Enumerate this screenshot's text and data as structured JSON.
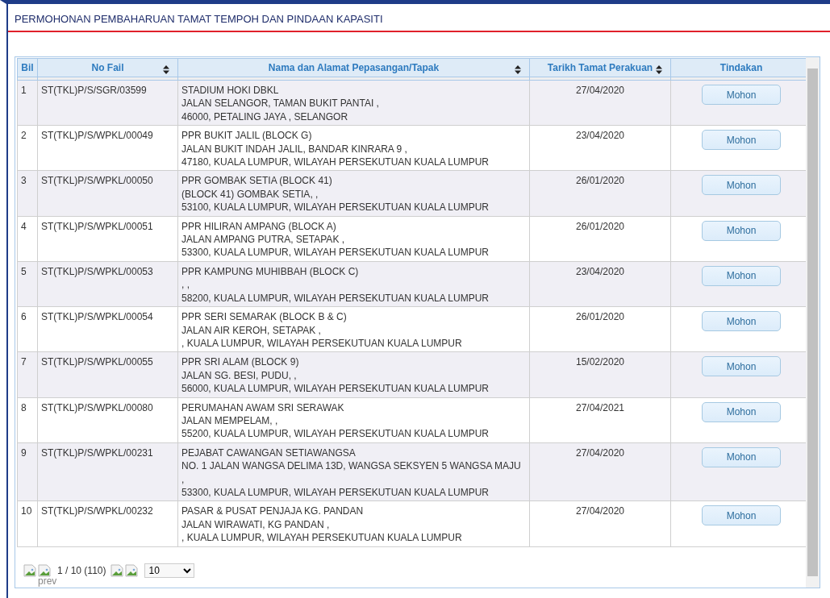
{
  "page_title": "PERMOHONAN PEMBAHARUAN TAMAT TEMPOH DAN PINDAAN KAPASITI",
  "table": {
    "columns": [
      {
        "label": "Bil",
        "sortable": false
      },
      {
        "label": "No Fail",
        "sortable": true
      },
      {
        "label": "Nama dan Alamat Pepasangan/Tapak",
        "sortable": true
      },
      {
        "label": "Tarikh Tamat Perakuan",
        "sortable": true
      },
      {
        "label": "Tindakan",
        "sortable": false
      }
    ],
    "rows": [
      {
        "bil": "1",
        "no_fail": "ST(TKL)P/S/SGR/03599",
        "address": [
          "STADIUM HOKI DBKL",
          "JALAN SELANGOR, TAMAN BUKIT PANTAI ,",
          "46000, PETALING JAYA , SELANGOR"
        ],
        "date": "27/04/2020",
        "action": "Mohon"
      },
      {
        "bil": "2",
        "no_fail": "ST(TKL)P/S/WPKL/00049",
        "address": [
          "PPR BUKIT JALIL (BLOCK G)",
          "JALAN BUKIT INDAH JALIL, BANDAR KINRARA 9 ,",
          "47180, KUALA LUMPUR, WILAYAH PERSEKUTUAN KUALA LUMPUR"
        ],
        "date": "23/04/2020",
        "action": "Mohon"
      },
      {
        "bil": "3",
        "no_fail": "ST(TKL)P/S/WPKL/00050",
        "address": [
          "PPR GOMBAK SETIA (BLOCK 41)",
          "(BLOCK 41) GOMBAK SETIA, ,",
          "53100, KUALA LUMPUR, WILAYAH PERSEKUTUAN KUALA LUMPUR"
        ],
        "date": "26/01/2020",
        "action": "Mohon"
      },
      {
        "bil": "4",
        "no_fail": "ST(TKL)P/S/WPKL/00051",
        "address": [
          "PPR HILIRAN AMPANG (BLOCK A)",
          "JALAN AMPANG PUTRA, SETAPAK ,",
          "53300, KUALA LUMPUR, WILAYAH PERSEKUTUAN KUALA LUMPUR"
        ],
        "date": "26/01/2020",
        "action": "Mohon"
      },
      {
        "bil": "5",
        "no_fail": "ST(TKL)P/S/WPKL/00053",
        "address": [
          "PPR KAMPUNG MUHIBBAH (BLOCK C)",
          ", ,",
          "58200, KUALA LUMPUR, WILAYAH PERSEKUTUAN KUALA LUMPUR"
        ],
        "date": "23/04/2020",
        "action": "Mohon"
      },
      {
        "bil": "6",
        "no_fail": "ST(TKL)P/S/WPKL/00054",
        "address": [
          "PPR SERI SEMARAK (BLOCK B & C)",
          "JALAN AIR KEROH, SETAPAK ,",
          ", KUALA LUMPUR, WILAYAH PERSEKUTUAN KUALA LUMPUR"
        ],
        "date": "26/01/2020",
        "action": "Mohon"
      },
      {
        "bil": "7",
        "no_fail": "ST(TKL)P/S/WPKL/00055",
        "address": [
          "PPR SRI ALAM (BLOCK 9)",
          "JALAN SG. BESI, PUDU, ,",
          "56000, KUALA LUMPUR, WILAYAH PERSEKUTUAN KUALA LUMPUR"
        ],
        "date": "15/02/2020",
        "action": "Mohon"
      },
      {
        "bil": "8",
        "no_fail": "ST(TKL)P/S/WPKL/00080",
        "address": [
          "PERUMAHAN AWAM SRI SERAWAK",
          "JALAN MEMPELAM, ,",
          "55200, KUALA LUMPUR, WILAYAH PERSEKUTUAN KUALA LUMPUR"
        ],
        "date": "27/04/2021",
        "action": "Mohon"
      },
      {
        "bil": "9",
        "no_fail": "ST(TKL)P/S/WPKL/00231",
        "address": [
          "PEJABAT CAWANGAN SETIAWANGSA",
          "NO. 1 JALAN WANGSA DELIMA 13D, WANGSA SEKSYEN 5 WANGSA MAJU",
          ",",
          "53300, KUALA LUMPUR, WILAYAH PERSEKUTUAN KUALA LUMPUR"
        ],
        "date": "27/04/2020",
        "action": "Mohon"
      },
      {
        "bil": "10",
        "no_fail": "ST(TKL)P/S/WPKL/00232",
        "address": [
          "PASAR & PUSAT PENJAJA KG. PANDAN",
          "JALAN WIRAWATI, KG PANDAN ,",
          ", KUALA LUMPUR, WILAYAH PERSEKUTUAN KUALA LUMPUR"
        ],
        "date": "27/04/2020",
        "action": "Mohon"
      }
    ]
  },
  "pager": {
    "prev_alt": "prev",
    "page_info": "1 / 10 (110)",
    "page_size": "10"
  }
}
